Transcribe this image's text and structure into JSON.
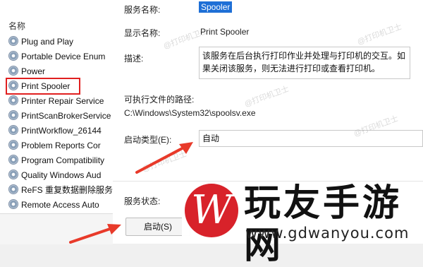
{
  "services": {
    "header": "名称",
    "items": [
      "Plug and Play",
      "Portable Device Enum",
      "Power",
      "Print Spooler",
      "Printer Repair Service",
      "PrintScanBrokerService",
      "PrintWorkflow_26144",
      "Problem Reports Cor",
      "Program Compatibility",
      "Quality Windows Aud",
      "ReFS 重复数据删除服务",
      "Remote Access Auto"
    ],
    "highlighted": "Print Spooler"
  },
  "props": {
    "service_name_label": "服务名称:",
    "service_name_value": "Spooler",
    "display_name_label": "显示名称:",
    "display_name_value": "Print Spooler",
    "description_label": "描述:",
    "description_value": "该服务在后台执行打印作业并处理与打印机的交互。如果关闭该服务，则无法进行打印或查看打印机。",
    "path_label": "可执行文件的路径:",
    "path_value": "C:\\Windows\\System32\\spoolsv.exe",
    "startup_type_label": "启动类型(E):",
    "startup_type_value": "自动",
    "service_status_label": "服务状态:",
    "start_button": "启动(S)"
  },
  "watermark": {
    "overlay_text": "@打印机卫士",
    "title": "玩友手游网",
    "url": "www.gdwanyou.com",
    "logo_letter": "W"
  },
  "colors": {
    "highlight_border": "#e02020",
    "arrow": "#e83a2a",
    "selection": "#1e6fd6",
    "logo": "#d8222a"
  }
}
